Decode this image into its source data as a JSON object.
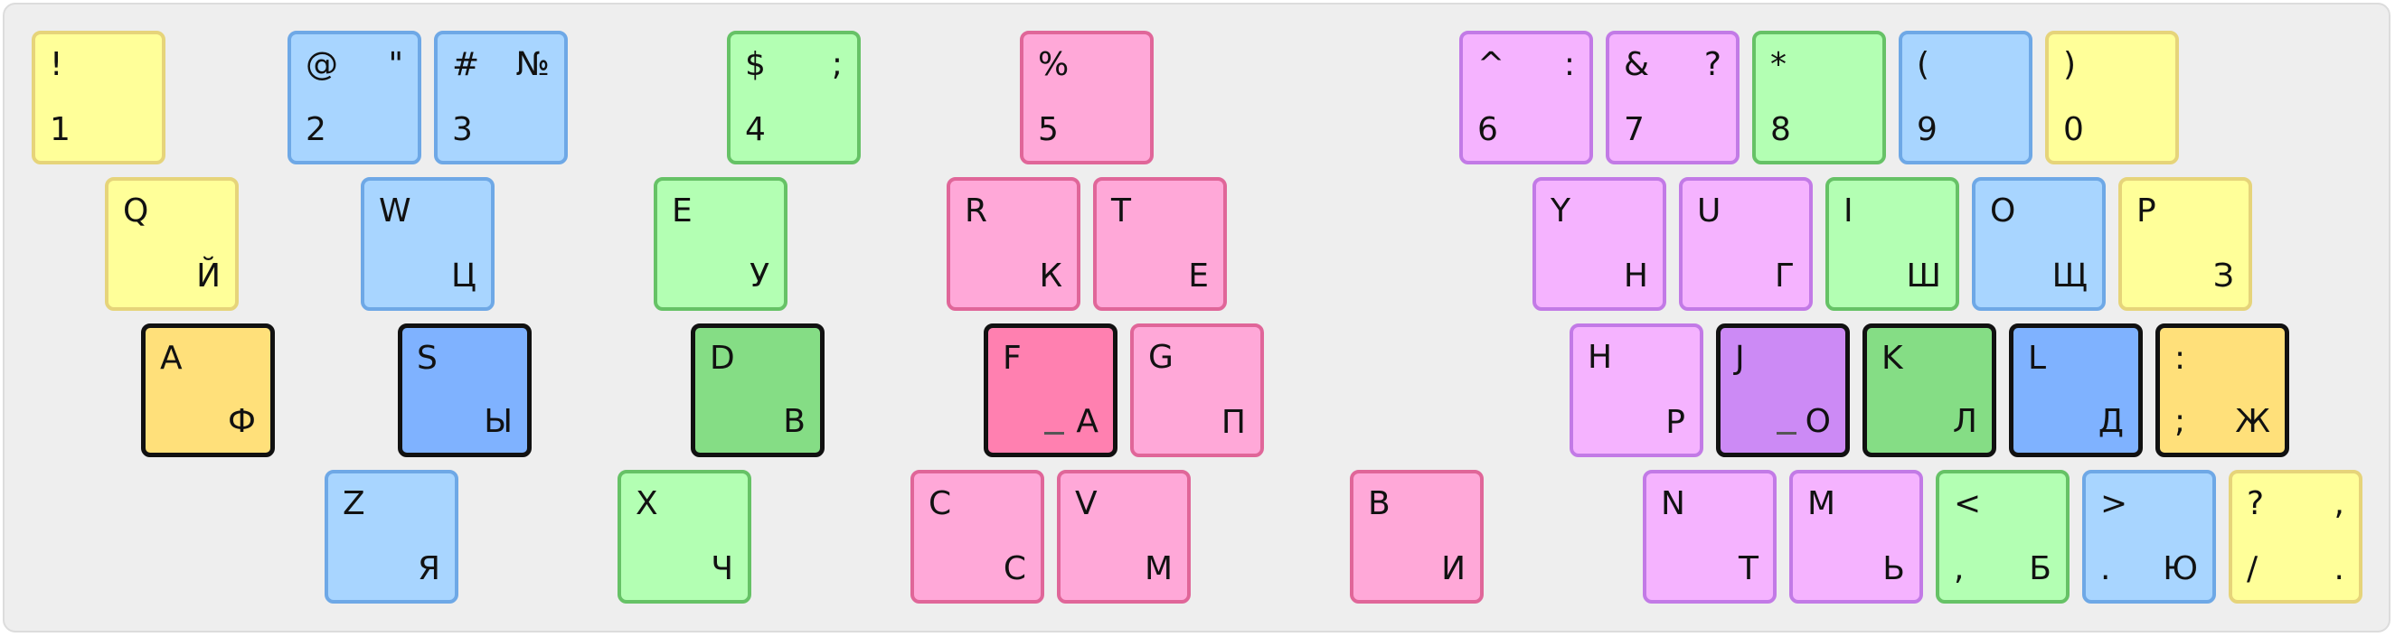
{
  "colors": {
    "yellow": {
      "fill": "#ffff99",
      "border": "#e6d47a",
      "home": "#ffe07a"
    },
    "blue": {
      "fill": "#a8d5ff",
      "border": "#6ea8e6",
      "home": "#7fb2ff"
    },
    "green": {
      "fill": "#b3ffb3",
      "border": "#66c266",
      "home": "#85dd85"
    },
    "pink": {
      "fill": "#ffa8d8",
      "border": "#e06699",
      "home": "#ff80b0"
    },
    "violet": {
      "fill": "#f5b3ff",
      "border": "#c27ae6",
      "home": "#cc8af5"
    }
  },
  "keys": [
    {
      "id": "1",
      "color": "yellow",
      "tl": "!",
      "tr": "",
      "bl": "1",
      "br": ""
    },
    {
      "id": "2",
      "color": "blue",
      "tl": "@",
      "tr": "\"",
      "bl": "2",
      "br": ""
    },
    {
      "id": "3",
      "color": "blue",
      "tl": "#",
      "tr": "№",
      "bl": "3",
      "br": ""
    },
    {
      "id": "4",
      "color": "green",
      "tl": "$",
      "tr": ";",
      "bl": "4",
      "br": ""
    },
    {
      "id": "5",
      "color": "pink",
      "tl": "%",
      "tr": "",
      "bl": "5",
      "br": ""
    },
    {
      "id": "6",
      "color": "violet",
      "tl": "^",
      "tr": ":",
      "bl": "6",
      "br": ""
    },
    {
      "id": "7",
      "color": "violet",
      "tl": "&",
      "tr": "?",
      "bl": "7",
      "br": ""
    },
    {
      "id": "8",
      "color": "green",
      "tl": "*",
      "tr": "",
      "bl": "8",
      "br": ""
    },
    {
      "id": "9",
      "color": "blue",
      "tl": "(",
      "tr": "",
      "bl": "9",
      "br": ""
    },
    {
      "id": "0",
      "color": "yellow",
      "tl": ")",
      "tr": "",
      "bl": "0",
      "br": ""
    },
    {
      "id": "q",
      "color": "yellow",
      "tl": "Q",
      "tr": "",
      "bl": "",
      "br": "Й"
    },
    {
      "id": "w",
      "color": "blue",
      "tl": "W",
      "tr": "",
      "bl": "",
      "br": "Ц"
    },
    {
      "id": "e",
      "color": "green",
      "tl": "E",
      "tr": "",
      "bl": "",
      "br": "У"
    },
    {
      "id": "r",
      "color": "pink",
      "tl": "R",
      "tr": "",
      "bl": "",
      "br": "К"
    },
    {
      "id": "t",
      "color": "pink",
      "tl": "T",
      "tr": "",
      "bl": "",
      "br": "Е"
    },
    {
      "id": "y",
      "color": "violet",
      "tl": "Y",
      "tr": "",
      "bl": "",
      "br": "Н"
    },
    {
      "id": "u",
      "color": "violet",
      "tl": "U",
      "tr": "",
      "bl": "",
      "br": "Г"
    },
    {
      "id": "i",
      "color": "green",
      "tl": "I",
      "tr": "",
      "bl": "",
      "br": "Ш"
    },
    {
      "id": "o",
      "color": "blue",
      "tl": "O",
      "tr": "",
      "bl": "",
      "br": "Щ"
    },
    {
      "id": "p",
      "color": "yellow",
      "tl": "P",
      "tr": "",
      "bl": "",
      "br": "З"
    },
    {
      "id": "a",
      "color": "yellow",
      "home": true,
      "tl": "A",
      "tr": "",
      "bl": "",
      "br": "Ф"
    },
    {
      "id": "s",
      "color": "blue",
      "home": true,
      "tl": "S",
      "tr": "",
      "bl": "",
      "br": "Ы"
    },
    {
      "id": "d",
      "color": "green",
      "home": true,
      "tl": "D",
      "tr": "",
      "bl": "",
      "br": "В"
    },
    {
      "id": "f",
      "color": "pink",
      "home": true,
      "bump": true,
      "tl": "F",
      "tr": "",
      "bl": "",
      "br": "А"
    },
    {
      "id": "g",
      "color": "pink",
      "tl": "G",
      "tr": "",
      "bl": "",
      "br": "П"
    },
    {
      "id": "h",
      "color": "violet",
      "tl": "H",
      "tr": "",
      "bl": "",
      "br": "Р"
    },
    {
      "id": "j",
      "color": "violet",
      "home": true,
      "bump": true,
      "tl": "J",
      "tr": "",
      "bl": "",
      "br": "О"
    },
    {
      "id": "k",
      "color": "green",
      "home": true,
      "tl": "K",
      "tr": "",
      "bl": "",
      "br": "Л"
    },
    {
      "id": "l",
      "color": "blue",
      "home": true,
      "tl": "L",
      "tr": "",
      "bl": "",
      "br": "Д"
    },
    {
      "id": "semicolon",
      "color": "yellow",
      "home": true,
      "tl": ":",
      "tr": "",
      "bl": ";",
      "br": "Ж"
    },
    {
      "id": "z",
      "color": "blue",
      "tl": "Z",
      "tr": "",
      "bl": "",
      "br": "Я"
    },
    {
      "id": "x",
      "color": "green",
      "tl": "X",
      "tr": "",
      "bl": "",
      "br": "Ч"
    },
    {
      "id": "c",
      "color": "pink",
      "tl": "C",
      "tr": "",
      "bl": "",
      "br": "С"
    },
    {
      "id": "v",
      "color": "pink",
      "tl": "V",
      "tr": "",
      "bl": "",
      "br": "М"
    },
    {
      "id": "b",
      "color": "pink",
      "tl": "B",
      "tr": "",
      "bl": "",
      "br": "И"
    },
    {
      "id": "n",
      "color": "violet",
      "tl": "N",
      "tr": "",
      "bl": "",
      "br": "Т"
    },
    {
      "id": "m",
      "color": "violet",
      "tl": "M",
      "tr": "",
      "bl": "",
      "br": "Ь"
    },
    {
      "id": "comma",
      "color": "green",
      "tl": "<",
      "tr": "",
      "bl": ",",
      "br": "Б"
    },
    {
      "id": "period",
      "color": "blue",
      "tl": ">",
      "tr": "",
      "bl": ".",
      "br": "Ю"
    },
    {
      "id": "slash",
      "color": "yellow",
      "tl": "?",
      "tr": ",",
      "bl": "/",
      "br": "."
    }
  ]
}
